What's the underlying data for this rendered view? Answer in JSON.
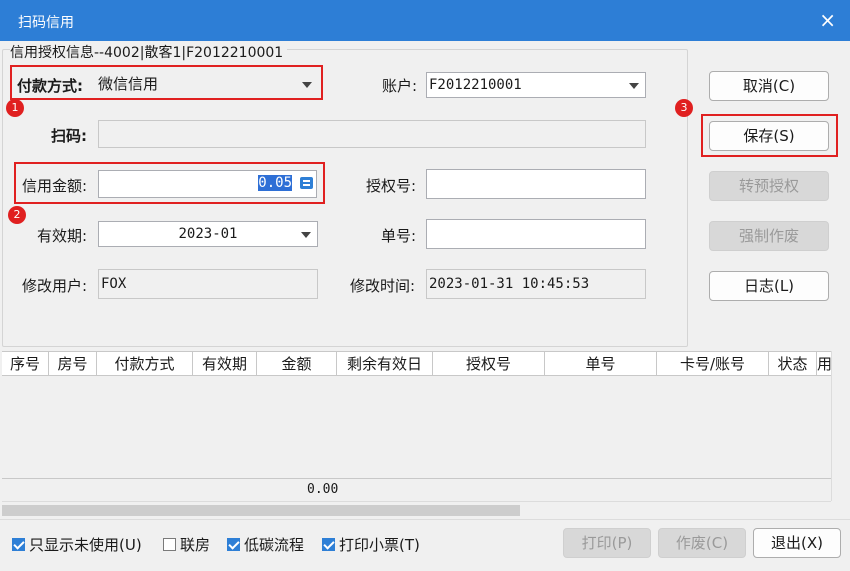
{
  "window": {
    "title": "扫码信用",
    "close_glyph": "×"
  },
  "group_caption": "信用授权信息--4002|散客1|F2012210001",
  "form": {
    "payment_method_label": "付款方式:",
    "payment_method_value": "微信信用",
    "account_label": "账户:",
    "account_value": "F2012210001",
    "scan_label": "扫码:",
    "scan_value": "",
    "credit_amount_label": "信用金额:",
    "credit_amount_value": "0.05",
    "auth_no_label": "授权号:",
    "auth_no_value": "",
    "validity_label": "有效期:",
    "validity_value": "2023-01",
    "order_no_label": "单号:",
    "order_no_value": "",
    "modified_user_label": "修改用户:",
    "modified_user_value": "FOX",
    "modified_time_label": "修改时间:",
    "modified_time_value": "2023-01-31 10:45:53"
  },
  "buttons": {
    "cancel": "取消(C)",
    "save": "保存(S)",
    "pre_auth": "转预授权",
    "force_void": "强制作废",
    "log": "日志(L)",
    "print": "打印(P)",
    "void": "作废(C)",
    "exit": "退出(X)"
  },
  "annotations": [
    "1",
    "2",
    "3"
  ],
  "table": {
    "columns": [
      "序号",
      "房号",
      "付款方式",
      "有效期",
      "金额",
      "剩余有效日",
      "授权号",
      "单号",
      "卡号/账号",
      "状态",
      "用"
    ],
    "rows": [],
    "total": "0.00"
  },
  "footer": {
    "only_unused": {
      "label": "只显示未使用(U)",
      "checked": true
    },
    "linked_room": {
      "label": "联房",
      "checked": false
    },
    "low_carbon": {
      "label": "低碳流程",
      "checked": true
    },
    "print_receipt": {
      "label": "打印小票(T)",
      "checked": true
    }
  },
  "colors": {
    "titlebar": "#2d7ed6",
    "annotation_red": "#e02020",
    "selection": "#2e6fd6"
  }
}
